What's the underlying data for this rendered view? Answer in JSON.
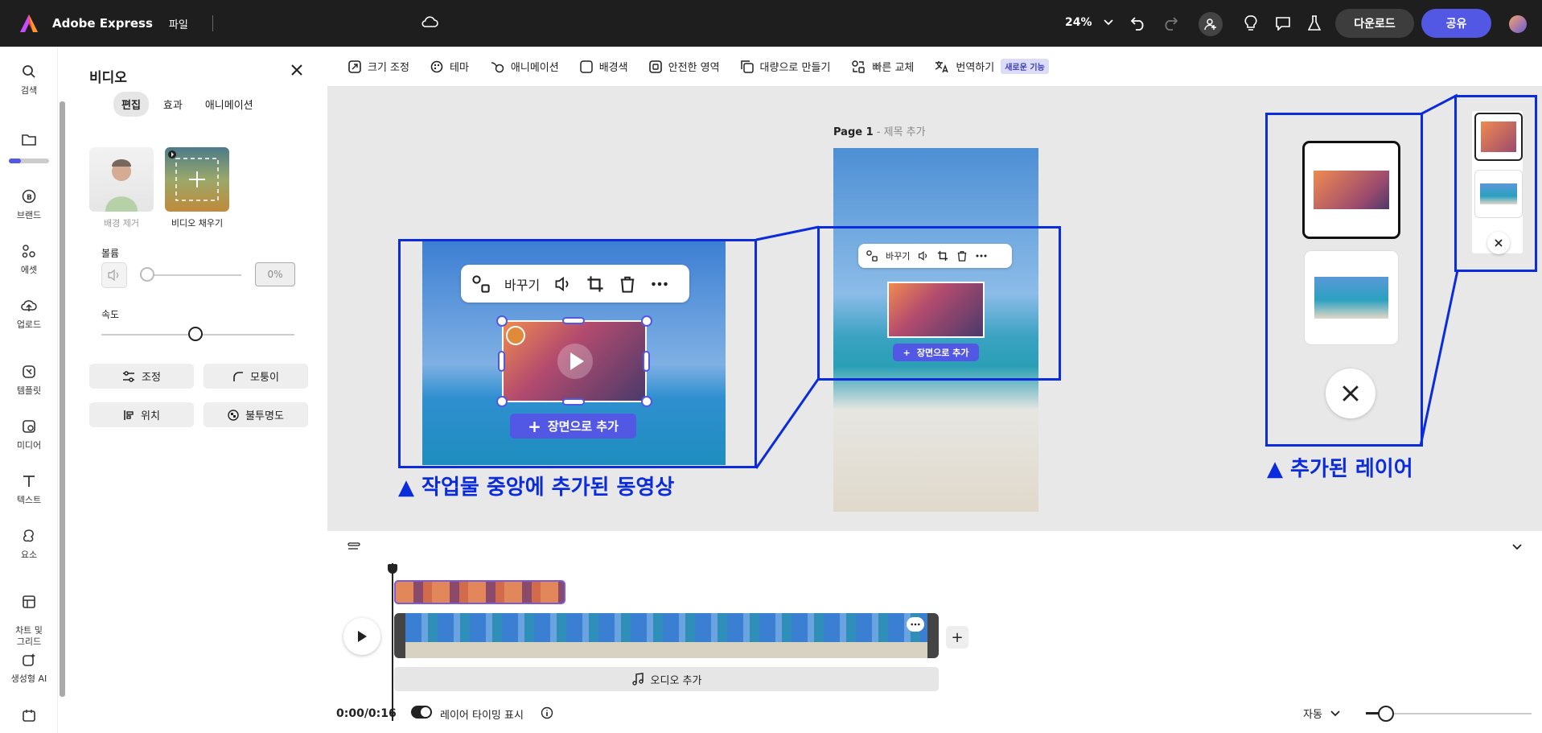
{
  "topbar": {
    "app_title": "Adobe Express",
    "file_menu": "파일",
    "zoom": "24%",
    "download": "다운로드",
    "share": "공유"
  },
  "rail": {
    "items": [
      {
        "label": "검색",
        "icon": "search-icon"
      },
      {
        "label": "",
        "icon": "folder-icon"
      },
      {
        "label": "브랜드",
        "icon": "brand-icon"
      },
      {
        "label": "에셋",
        "icon": "assets-icon"
      },
      {
        "label": "업로드",
        "icon": "upload-icon"
      },
      {
        "label": "템플릿",
        "icon": "template-icon"
      },
      {
        "label": "미디어",
        "icon": "media-icon"
      },
      {
        "label": "텍스트",
        "icon": "text-icon"
      },
      {
        "label": "요소",
        "icon": "elements-icon"
      },
      {
        "label": "차트 및\n그리드",
        "icon": "chart-grid-icon"
      },
      {
        "label": "생성형 AI",
        "icon": "generative-ai-icon"
      },
      {
        "label": "",
        "icon": "calendar-icon"
      }
    ],
    "storage_progress": 0.3
  },
  "panel": {
    "title": "비디오",
    "tabs": [
      "편집",
      "효과",
      "애니메이션"
    ],
    "active_tab": "편집",
    "thumb1_label": "배경 제거",
    "thumb2_label": "비디오 채우기",
    "volume_label": "볼륨",
    "volume_value": "0%",
    "speed_label": "속도",
    "buttons": [
      "조정",
      "모퉁이",
      "위치",
      "불투명도"
    ]
  },
  "toolbar": {
    "items": [
      "크기 조정",
      "테마",
      "애니메이션",
      "배경색",
      "안전한 영역",
      "대량으로 만들기",
      "빠른 교체",
      "번역하기"
    ],
    "new_badge": "새로운 기능"
  },
  "canvas": {
    "page_label": "Page 1",
    "page_sub": " - 제목 추가",
    "replace": "바꾸기",
    "add_scene": "장면으로 추가",
    "callout_left": "▲ 작업물 중앙에 추가된 동영상",
    "callout_right": "▲ 추가된 레이어"
  },
  "timeline": {
    "add_audio": "오디오 추가",
    "time": "0:00/0:16",
    "layer_timing": "레이어 타이밍 표시",
    "auto": "자동"
  },
  "colors": {
    "accent": "#5258e4",
    "highlight": "#0a2cdc",
    "topbar_bg": "#1e1e1e"
  }
}
